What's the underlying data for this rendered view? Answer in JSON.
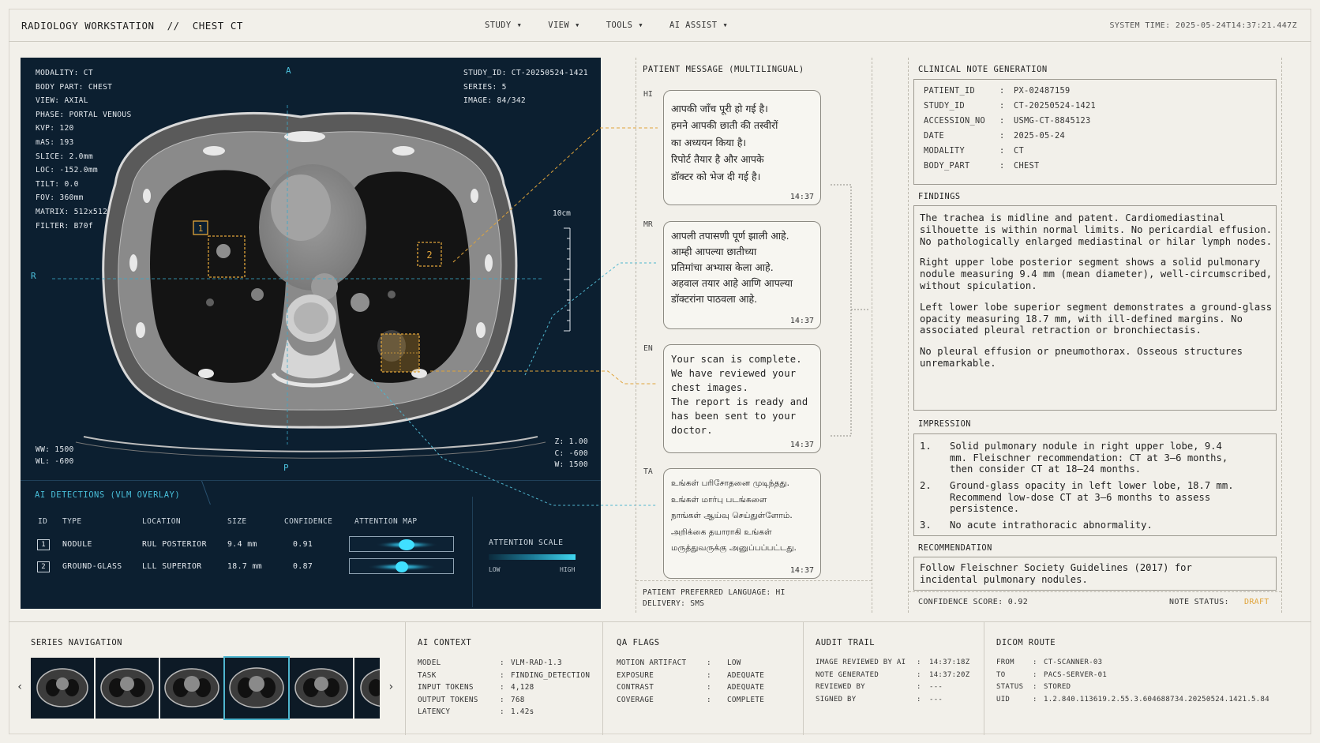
{
  "header": {
    "title": "RADIOLOGY WORKSTATION  //  CHEST CT",
    "menu": [
      "STUDY",
      "VIEW",
      "TOOLS",
      "AI ASSIST"
    ],
    "system_time": "SYSTEM TIME: 2025-05-24T14:37:21.447Z"
  },
  "viewer": {
    "overlay_tl": [
      "MODALITY: CT",
      "BODY PART: CHEST",
      "VIEW: AXIAL",
      "PHASE: PORTAL VENOUS",
      "KVP: 120",
      "mAS: 193",
      "SLICE: 2.0mm",
      "LOC: -152.0mm",
      "TILT: 0.0",
      "FOV: 360mm",
      "MATRIX: 512x512",
      "FILTER: B70f"
    ],
    "overlay_tr": [
      "STUDY_ID: CT-20250524-1421",
      "SERIES: 5",
      "IMAGE: 84/342"
    ],
    "overlay_bl": [
      "WW: 1500",
      "WL: -600"
    ],
    "overlay_br": [
      "Z: 1.00",
      "C: -600",
      "W: 1500"
    ],
    "orient": {
      "top": "A",
      "bottom": "P",
      "left": "R"
    },
    "scale_label": "10cm",
    "box_labels": [
      "1",
      "2"
    ]
  },
  "detections": {
    "tab": "AI DETECTIONS (VLM OVERLAY)",
    "headers": [
      "ID",
      "TYPE",
      "LOCATION",
      "SIZE",
      "CONFIDENCE",
      "ATTENTION MAP"
    ],
    "rows": [
      {
        "id": "1",
        "type": "NODULE",
        "location": "RUL POSTERIOR",
        "size": "9.4 mm",
        "confidence": "0.91"
      },
      {
        "id": "2",
        "type": "GROUND-GLASS",
        "location": "LLL SUPERIOR",
        "size": "18.7 mm",
        "confidence": "0.87"
      }
    ],
    "scale_label": "ATTENTION SCALE",
    "scale_low": "LOW",
    "scale_high": "HIGH"
  },
  "messages": {
    "title": "PATIENT MESSAGE (MULTILINGUAL)",
    "items": [
      {
        "lang": "HI",
        "lines": [
          "आपकी जाँच पूरी हो गई है।",
          "हमने आपकी छाती की तस्वीरों",
          "का अध्ययन किया है।",
          "रिपोर्ट तैयार है और आपके",
          "डॉक्टर को भेज दी गई है।"
        ],
        "time": "14:37"
      },
      {
        "lang": "MR",
        "lines": [
          "आपली तपासणी पूर्ण झाली आहे.",
          "आम्ही आपल्या छातीच्या",
          "प्रतिमांचा अभ्यास केला आहे.",
          "अहवाल तयार आहे आणि आपल्या",
          "डॉक्टरांना पाठवला आहे."
        ],
        "time": "14:37"
      },
      {
        "lang": "EN",
        "lines": [
          "Your scan is complete.",
          "We have reviewed your",
          "chest images.",
          "The report is ready and",
          "has been sent to your",
          "doctor."
        ],
        "time": "14:37"
      },
      {
        "lang": "TA",
        "lines": [
          "உங்கள் பரிசோதனை முடிந்தது.",
          "உங்கள் மார்பு படங்களை",
          "நாங்கள் ஆய்வு செய்துள்ளோம்.",
          "அறிக்கை தயாராகி உங்கள்",
          "மருத்துவருக்கு அனுப்பப்பட்டது."
        ],
        "time": "14:37"
      }
    ],
    "footer_language": "PATIENT PREFERRED LANGUAGE: HI",
    "footer_delivery": "DELIVERY: SMS"
  },
  "note": {
    "title": "CLINICAL NOTE GENERATION",
    "meta": [
      {
        "k": "PATIENT_ID",
        "v": "PX-02487159"
      },
      {
        "k": "STUDY_ID",
        "v": "CT-20250524-1421"
      },
      {
        "k": "ACCESSION_NO",
        "v": "USMG-CT-8845123"
      },
      {
        "k": "DATE",
        "v": "2025-05-24"
      },
      {
        "k": "MODALITY",
        "v": "CT"
      },
      {
        "k": "BODY_PART",
        "v": "CHEST"
      }
    ],
    "findings_title": "FINDINGS",
    "findings": [
      "The trachea is midline and patent. Cardiomediastinal silhouette is within normal limits. No pericardial effusion. No pathologically enlarged mediastinal or hilar lymph nodes.",
      "Right upper lobe posterior segment shows a solid pulmonary nodule measuring 9.4 mm (mean diameter), well-circumscribed, without spiculation.",
      "Left lower lobe superior segment demonstrates a ground-glass opacity measuring 18.7 mm, with ill-defined margins. No associated pleural retraction or bronchiectasis.",
      "No pleural effusion or pneumothorax. Osseous structures unremarkable."
    ],
    "impression_title": "IMPRESSION",
    "impression": [
      {
        "n": "1.",
        "t": "Solid pulmonary nodule in right upper lobe, 9.4 mm. Fleischner recommendation: CT at 3–6 months, then consider CT at 18–24 months."
      },
      {
        "n": "2.",
        "t": "Ground-glass opacity in left lower lobe, 18.7 mm. Recommend low-dose CT at 3–6 months to assess persistence."
      },
      {
        "n": "3.",
        "t": "No acute intrathoracic abnormality."
      }
    ],
    "recommendation_title": "RECOMMENDATION",
    "recommendation": "Follow Fleischner Society Guidelines (2017) for incidental pulmonary nodules.",
    "confidence": "CONFIDENCE SCORE: 0.92",
    "status_label": "NOTE STATUS:",
    "status_value": "DRAFT",
    "status_color": "#e0a43a"
  },
  "bottom": {
    "series_title": "SERIES NAVIGATION",
    "ai_context": {
      "title": "AI CONTEXT",
      "rows": [
        {
          "k": "MODEL",
          "v": "VLM-RAD-1.3"
        },
        {
          "k": "TASK",
          "v": "FINDING_DETECTION"
        },
        {
          "k": "INPUT TOKENS",
          "v": "4,128"
        },
        {
          "k": "OUTPUT TOKENS",
          "v": "768"
        },
        {
          "k": "LATENCY",
          "v": "1.42s"
        }
      ]
    },
    "qa_flags": {
      "title": "QA FLAGS",
      "rows": [
        {
          "k": "MOTION ARTIFACT",
          "v": "LOW"
        },
        {
          "k": "EXPOSURE",
          "v": "ADEQUATE"
        },
        {
          "k": "CONTRAST",
          "v": "ADEQUATE"
        },
        {
          "k": "COVERAGE",
          "v": "COMPLETE"
        }
      ]
    },
    "audit": {
      "title": "AUDIT TRAIL",
      "rows": [
        {
          "k": "IMAGE REVIEWED BY AI",
          "v": "14:37:18Z"
        },
        {
          "k": "NOTE GENERATED",
          "v": "14:37:20Z"
        },
        {
          "k": "REVIEWED BY",
          "v": "---"
        },
        {
          "k": "SIGNED BY",
          "v": "---"
        }
      ]
    },
    "dicom": {
      "title": "DICOM ROUTE",
      "rows": [
        {
          "k": "FROM",
          "v": "CT-SCANNER-03"
        },
        {
          "k": "TO",
          "v": "PACS-SERVER-01"
        },
        {
          "k": "STATUS",
          "v": "STORED"
        },
        {
          "k": "UID",
          "v": "1.2.840.113619.2.55.3.604688734.20250524.1421.5.84"
        }
      ]
    }
  }
}
